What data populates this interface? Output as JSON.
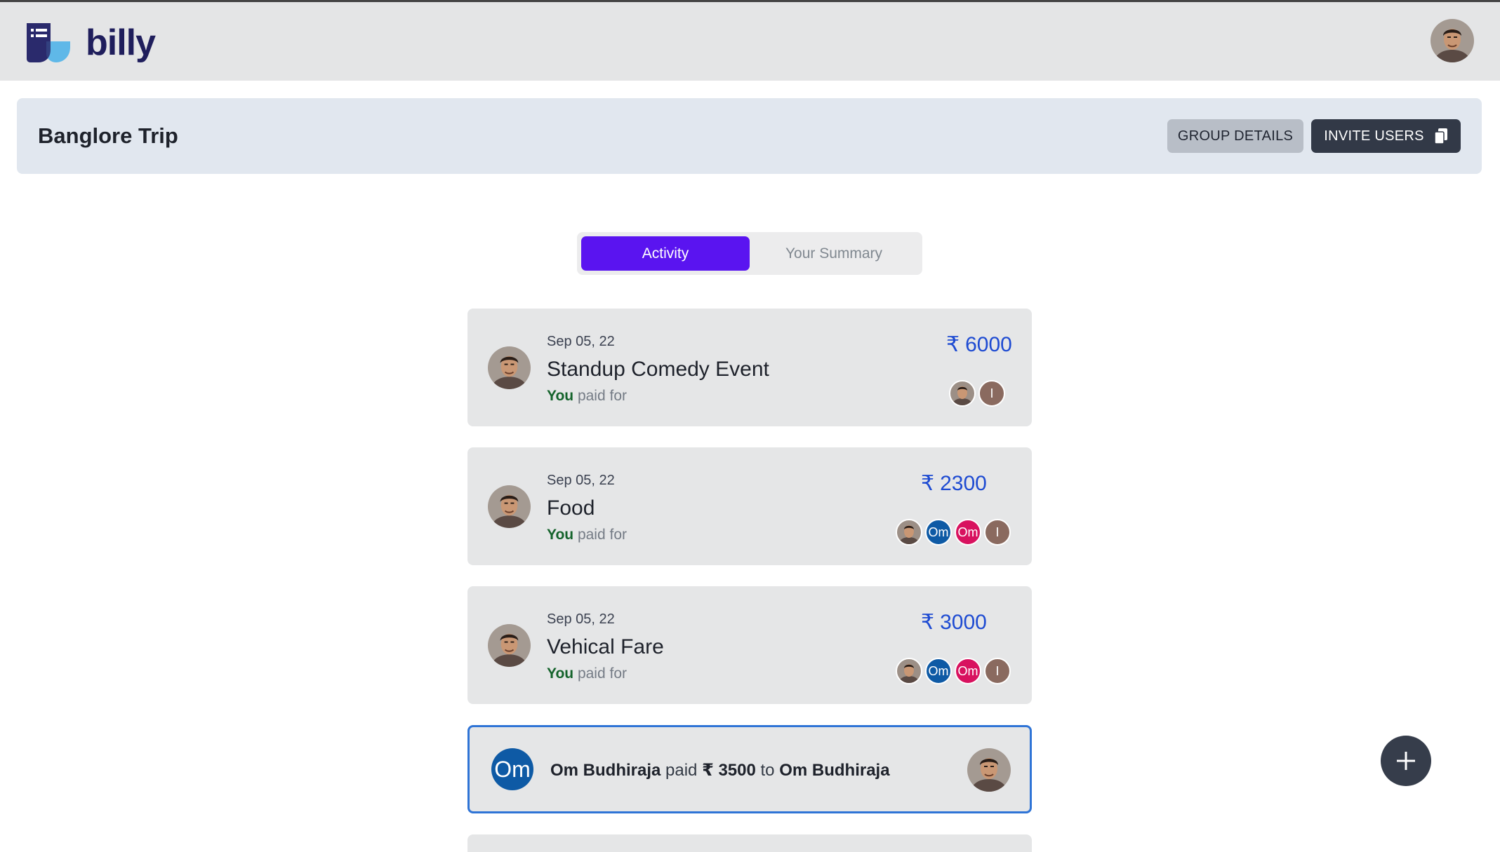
{
  "app": {
    "name": "billy",
    "brand_colors": {
      "navy": "#1f1e5c",
      "light_blue": "#5fb8e8"
    }
  },
  "header": {
    "avatar_icon": "user-avatar-photo"
  },
  "group": {
    "title": "Banglore Trip",
    "details_label": "GROUP DETAILS",
    "invite_label": "INVITE USERS",
    "invite_icon": "copy-icon"
  },
  "tabs": {
    "items": [
      {
        "label": "Activity",
        "active": true
      },
      {
        "label": "Your Summary",
        "active": false
      }
    ],
    "accent": "#5a14f0"
  },
  "expenses": [
    {
      "date": "Sep 05, 22",
      "title": "Standup Comedy Event",
      "payer": "You",
      "paid_text": "paid for",
      "currency": "₹",
      "amount": "6000",
      "participants": [
        {
          "type": "photo"
        },
        {
          "type": "initial",
          "label": "I",
          "color": "#8a6a5f"
        }
      ]
    },
    {
      "date": "Sep 05, 22",
      "title": "Food",
      "payer": "You",
      "paid_text": "paid for",
      "currency": "₹",
      "amount": "2300",
      "participants": [
        {
          "type": "photo"
        },
        {
          "type": "initial",
          "label": "Om",
          "color": "#0e5aa5"
        },
        {
          "type": "initial",
          "label": "Om",
          "color": "#d8125f"
        },
        {
          "type": "initial",
          "label": "I",
          "color": "#8a6a5f"
        }
      ]
    },
    {
      "date": "Sep 05, 22",
      "title": "Vehical Fare",
      "payer": "You",
      "paid_text": "paid for",
      "currency": "₹",
      "amount": "3000",
      "participants": [
        {
          "type": "photo"
        },
        {
          "type": "initial",
          "label": "Om",
          "color": "#0e5aa5"
        },
        {
          "type": "initial",
          "label": "Om",
          "color": "#d8125f"
        },
        {
          "type": "initial",
          "label": "I",
          "color": "#8a6a5f"
        }
      ]
    }
  ],
  "settlement": {
    "from_avatar": "Om",
    "from": "Om Budhiraja",
    "verb": "paid",
    "amount": "₹ 3500",
    "to_word": "to",
    "to": "Om Budhiraja"
  },
  "fab": {
    "icon": "plus-icon"
  }
}
